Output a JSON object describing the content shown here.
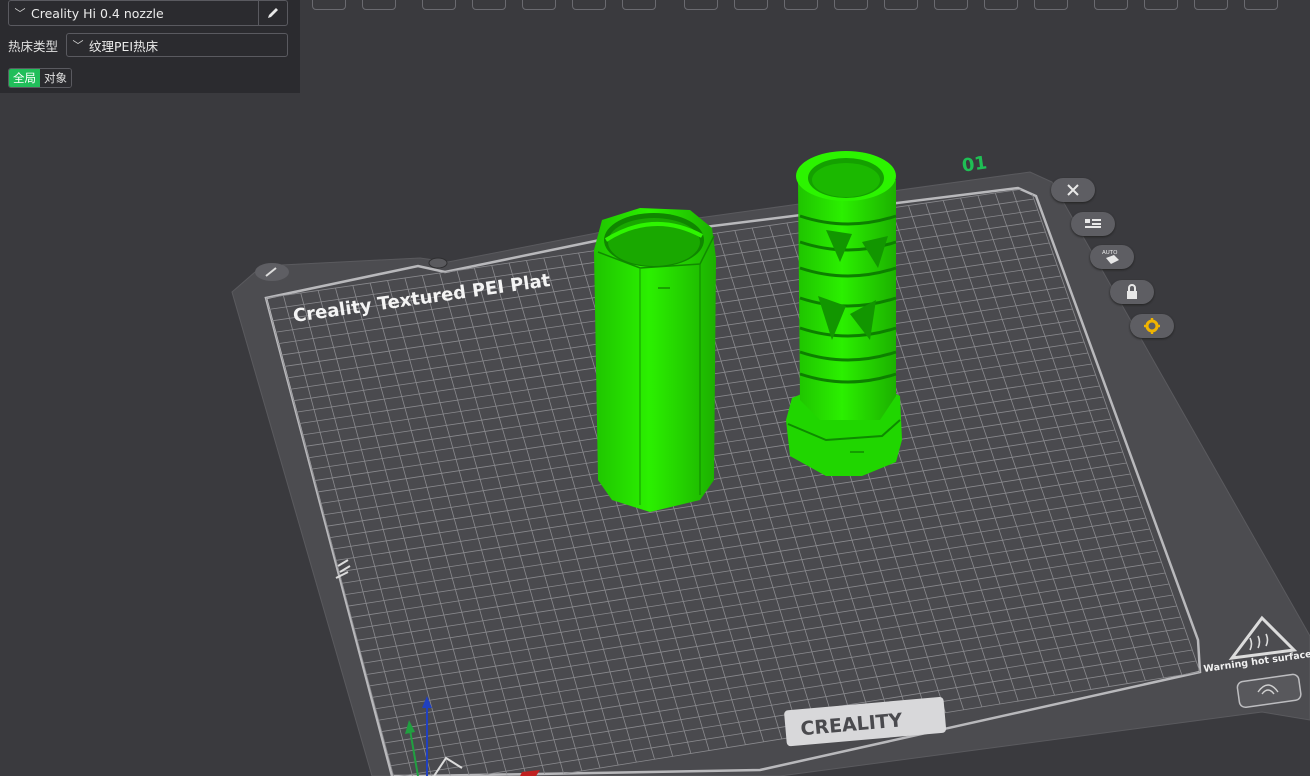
{
  "printer": {
    "name": "Creality Hi 0.4 nozzle"
  },
  "bed": {
    "label": "热床类型",
    "value": "纹理PEI热床"
  },
  "scope": {
    "global": "全局",
    "object": "对象"
  },
  "plate": {
    "title": "Creality Textured PEI Plat",
    "brand": "CREALITY",
    "warning": "Warning hot surface",
    "plate_number": "01"
  },
  "icons": {
    "printer_chevron": "chevron-down-icon",
    "edit": "pencil-icon",
    "bed_chevron": "chevron-down-icon",
    "close": "close-icon",
    "arrange": "list-icon",
    "auto_orient": "auto-orient-icon",
    "lock": "lock-icon",
    "settings": "gear-icon"
  },
  "colors": {
    "background": "#3a3a3e",
    "panel": "#2b2b2f",
    "accent": "#21be5a",
    "model": "#22e000",
    "bed": "#4a4a4d"
  },
  "toolbar_buttons": 26
}
